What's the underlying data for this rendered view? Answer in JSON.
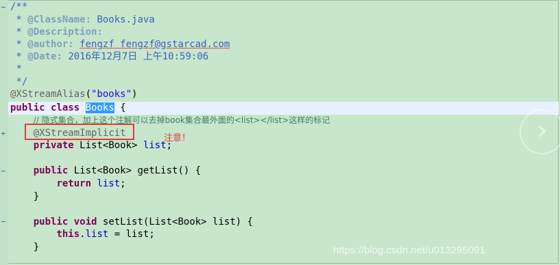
{
  "code": {
    "javadoc_open": "/**",
    "classname_tag": "@ClassName:",
    "classname_value": "Books.java",
    "description_tag": "@Description:",
    "author_tag": "@author:",
    "author_value": "fengzf fengzf@gstarcad.com",
    "date_tag": "@Date:",
    "date_value": "2016年12月7日 上午10:59:06",
    "javadoc_star": "*",
    "javadoc_close": "*/",
    "xstream_alias": "@XStreamAlias",
    "xstream_alias_value": "\"books\"",
    "kw_public": "public",
    "kw_class": "class",
    "class_name": "Books",
    "brace_open": "{",
    "comment_line": "// 隐式集合，加上这个注解可以去掉book集合最外面的<list></list>这样的标记",
    "xstream_implicit": "@XStreamImplicit",
    "kw_private": "private",
    "type_list_book": "List<Book>",
    "field_list": "list",
    "getter_sig": "getList() {",
    "kw_return": "return",
    "brace_close": "}",
    "kw_void": "void",
    "setter_sig_a": "setList(List<Book> list) {",
    "kw_this": "this",
    "assign_rest": " = list;"
  },
  "annotation_note": "注意！",
  "watermark": "https://blog.csdn.net/u013295091",
  "nav_icon": "chevron-right-icon"
}
